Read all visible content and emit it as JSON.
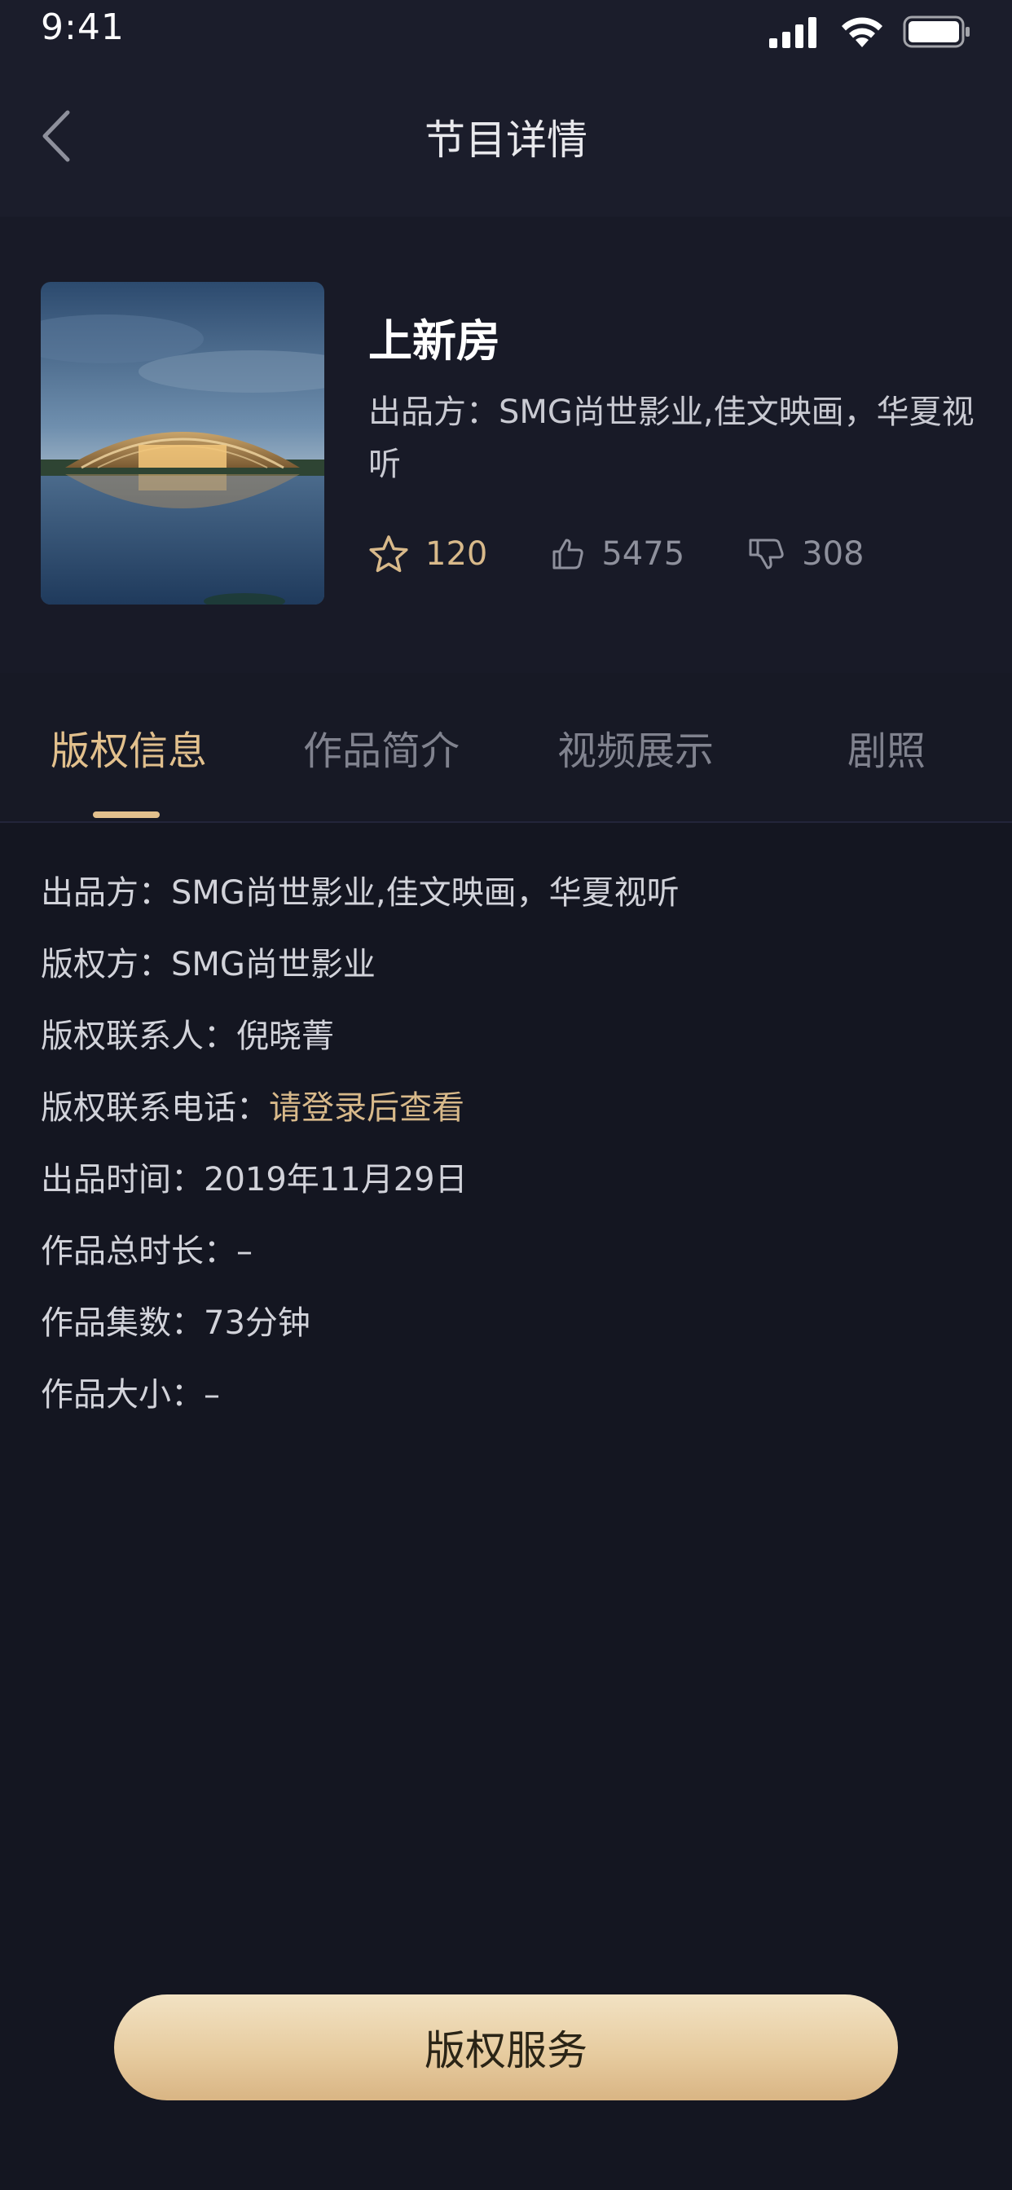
{
  "status_bar": {
    "time": "9:41"
  },
  "nav": {
    "title": "节目详情"
  },
  "program": {
    "title": "上新房",
    "producer_line": "出品方：SMG尚世影业,佳文映画，华夏视听",
    "favorites": "120",
    "likes": "5475",
    "dislikes": "308"
  },
  "tabs": [
    {
      "label": "版权信息",
      "active": true
    },
    {
      "label": "作品简介",
      "active": false
    },
    {
      "label": "视频展示",
      "active": false
    },
    {
      "label": "剧照",
      "active": false
    }
  ],
  "details": [
    {
      "label": "出品方：",
      "value": "SMG尚世影业,佳文映画，华夏视听"
    },
    {
      "label": "版权方：",
      "value": "SMG尚世影业"
    },
    {
      "label": "版权联系人：",
      "value": "倪晓菁"
    },
    {
      "label": "版权联系电话：",
      "value": "请登录后查看"
    },
    {
      "label": "出品时间：",
      "value": "2019年11月29日"
    },
    {
      "label": "作品总时长：",
      "value": "–"
    },
    {
      "label": "作品集数：",
      "value": "73分钟"
    },
    {
      "label": "作品大小：",
      "value": "–"
    }
  ],
  "service_button": {
    "label": "版权服务"
  },
  "icons": {
    "back": "chevron-left-icon",
    "favorite": "star-icon",
    "like": "thumbs-up-icon",
    "dislike": "thumbs-down-icon",
    "signal": "cellular-signal-icon",
    "wifi": "wifi-icon",
    "battery": "battery-icon"
  },
  "colors": {
    "background": "#141621",
    "accent": "#e2c08d",
    "link": "#d8b98a"
  }
}
